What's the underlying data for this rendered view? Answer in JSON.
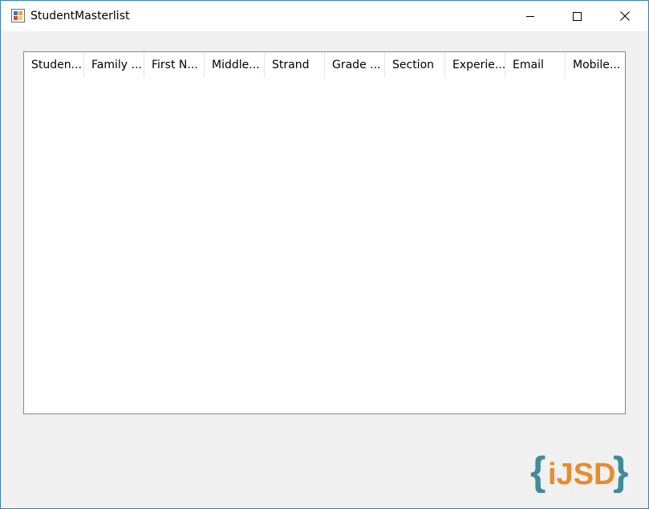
{
  "window": {
    "title": "StudentMasterlist",
    "controls": {
      "minimize": "minimize",
      "maximize": "maximize",
      "close": "close"
    }
  },
  "listview": {
    "columns": [
      "Studen...",
      "Family ...",
      "First N...",
      "Middle...",
      "Strand",
      "Grade ...",
      "Section",
      "Experie...",
      "Email",
      "Mobile..."
    ],
    "rows": []
  },
  "logo": {
    "text": "{iJSD}",
    "colors": {
      "brace": "#3f8b9a",
      "letters": "#e88b2e"
    }
  }
}
